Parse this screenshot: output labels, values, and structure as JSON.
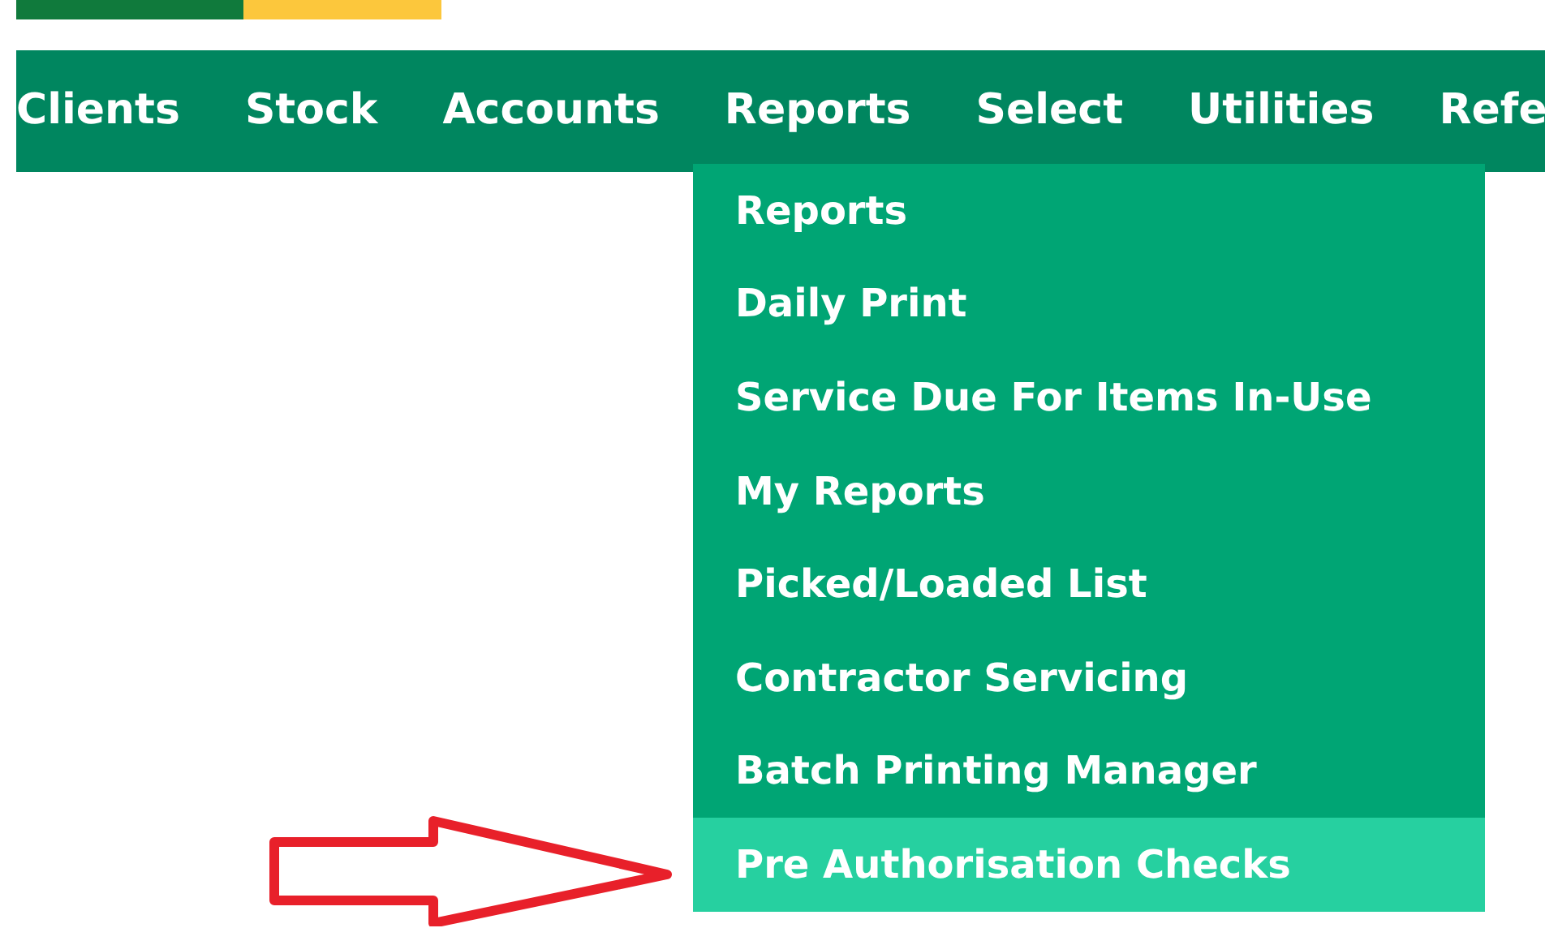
{
  "nav": {
    "items": [
      {
        "label": "Clients"
      },
      {
        "label": "Stock"
      },
      {
        "label": "Accounts"
      },
      {
        "label": "Reports"
      },
      {
        "label": "Select"
      },
      {
        "label": "Utilities"
      },
      {
        "label": "Refe"
      }
    ]
  },
  "dropdown": {
    "items": [
      {
        "label": "Reports",
        "selected": false
      },
      {
        "label": "Daily Print",
        "selected": false
      },
      {
        "label": "Service Due For Items In-Use",
        "selected": false
      },
      {
        "label": "My Reports",
        "selected": false
      },
      {
        "label": "Picked/Loaded List",
        "selected": false
      },
      {
        "label": "Contractor Servicing",
        "selected": false
      },
      {
        "label": "Batch Printing Manager",
        "selected": false
      },
      {
        "label": "Pre Authorisation Checks",
        "selected": true
      }
    ]
  }
}
